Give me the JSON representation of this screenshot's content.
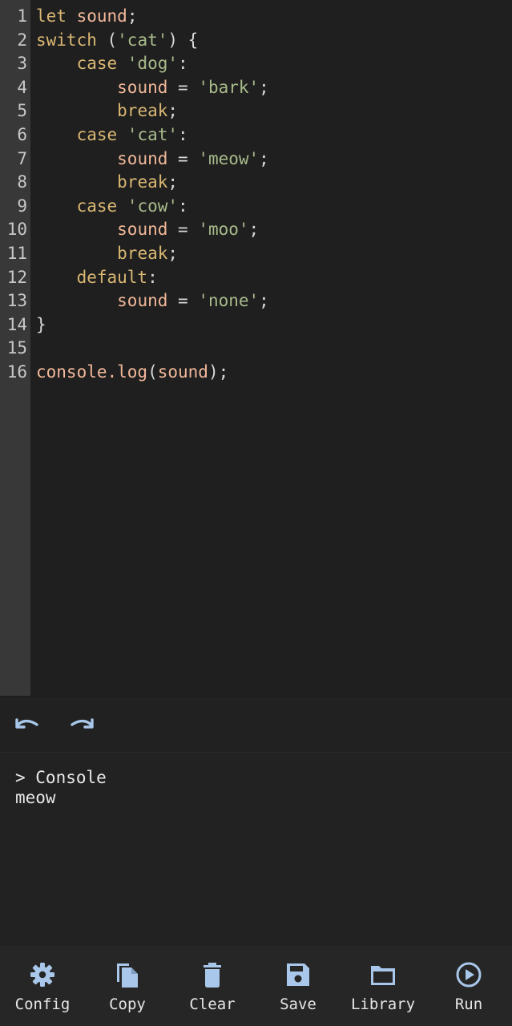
{
  "editor": {
    "lines": [
      {
        "num": "1",
        "tokens": [
          {
            "t": "let",
            "c": "keyword"
          },
          {
            "t": " ",
            "c": "space"
          },
          {
            "t": "sound",
            "c": "var"
          },
          {
            "t": ";",
            "c": "punct"
          }
        ]
      },
      {
        "num": "2",
        "tokens": [
          {
            "t": "switch",
            "c": "keyword"
          },
          {
            "t": " (",
            "c": "punct"
          },
          {
            "t": "'cat'",
            "c": "string"
          },
          {
            "t": ") {",
            "c": "punct"
          }
        ]
      },
      {
        "num": "3",
        "tokens": [
          {
            "t": "    ",
            "c": "space"
          },
          {
            "t": "case",
            "c": "keyword"
          },
          {
            "t": " ",
            "c": "space"
          },
          {
            "t": "'dog'",
            "c": "string"
          },
          {
            "t": ":",
            "c": "punct"
          }
        ]
      },
      {
        "num": "4",
        "tokens": [
          {
            "t": "        ",
            "c": "space"
          },
          {
            "t": "sound",
            "c": "var"
          },
          {
            "t": " = ",
            "c": "punct"
          },
          {
            "t": "'bark'",
            "c": "string"
          },
          {
            "t": ";",
            "c": "punct"
          }
        ]
      },
      {
        "num": "5",
        "tokens": [
          {
            "t": "        ",
            "c": "space"
          },
          {
            "t": "break",
            "c": "keyword"
          },
          {
            "t": ";",
            "c": "punct"
          }
        ]
      },
      {
        "num": "6",
        "tokens": [
          {
            "t": "    ",
            "c": "space"
          },
          {
            "t": "case",
            "c": "keyword"
          },
          {
            "t": " ",
            "c": "space"
          },
          {
            "t": "'cat'",
            "c": "string"
          },
          {
            "t": ":",
            "c": "punct"
          }
        ]
      },
      {
        "num": "7",
        "tokens": [
          {
            "t": "        ",
            "c": "space"
          },
          {
            "t": "sound",
            "c": "var"
          },
          {
            "t": " = ",
            "c": "punct"
          },
          {
            "t": "'meow'",
            "c": "string"
          },
          {
            "t": ";",
            "c": "punct"
          }
        ]
      },
      {
        "num": "8",
        "tokens": [
          {
            "t": "        ",
            "c": "space"
          },
          {
            "t": "break",
            "c": "keyword"
          },
          {
            "t": ";",
            "c": "punct"
          }
        ]
      },
      {
        "num": "9",
        "tokens": [
          {
            "t": "    ",
            "c": "space"
          },
          {
            "t": "case",
            "c": "keyword"
          },
          {
            "t": " ",
            "c": "space"
          },
          {
            "t": "'cow'",
            "c": "string"
          },
          {
            "t": ":",
            "c": "punct"
          }
        ]
      },
      {
        "num": "10",
        "tokens": [
          {
            "t": "        ",
            "c": "space"
          },
          {
            "t": "sound",
            "c": "var"
          },
          {
            "t": " = ",
            "c": "punct"
          },
          {
            "t": "'moo'",
            "c": "string"
          },
          {
            "t": ";",
            "c": "punct"
          }
        ]
      },
      {
        "num": "11",
        "tokens": [
          {
            "t": "        ",
            "c": "space"
          },
          {
            "t": "break",
            "c": "keyword"
          },
          {
            "t": ";",
            "c": "punct"
          }
        ]
      },
      {
        "num": "12",
        "tokens": [
          {
            "t": "    ",
            "c": "space"
          },
          {
            "t": "default",
            "c": "keyword"
          },
          {
            "t": ":",
            "c": "punct"
          }
        ]
      },
      {
        "num": "13",
        "tokens": [
          {
            "t": "        ",
            "c": "space"
          },
          {
            "t": "sound",
            "c": "var"
          },
          {
            "t": " = ",
            "c": "punct"
          },
          {
            "t": "'none'",
            "c": "string"
          },
          {
            "t": ";",
            "c": "punct"
          }
        ]
      },
      {
        "num": "14",
        "tokens": [
          {
            "t": "}",
            "c": "punct"
          }
        ]
      },
      {
        "num": "15",
        "tokens": []
      },
      {
        "num": "16",
        "tokens": [
          {
            "t": "console.log",
            "c": "var"
          },
          {
            "t": "(",
            "c": "punct"
          },
          {
            "t": "sound",
            "c": "var"
          },
          {
            "t": ");",
            "c": "punct"
          }
        ]
      }
    ]
  },
  "history": {
    "undo_icon": "undo-icon",
    "redo_icon": "redo-icon"
  },
  "console": {
    "header": "> Console",
    "output": "meow"
  },
  "nav": {
    "config_label": "Config",
    "copy_label": "Copy",
    "clear_label": "Clear",
    "save_label": "Save",
    "library_label": "Library",
    "run_label": "Run"
  },
  "colors": {
    "keyword": "#d9b773",
    "variable": "#f2b89a",
    "string": "#a8bb8b",
    "icon": "#a9c7ea",
    "background": "#1f1f1f",
    "gutter": "#383838"
  }
}
